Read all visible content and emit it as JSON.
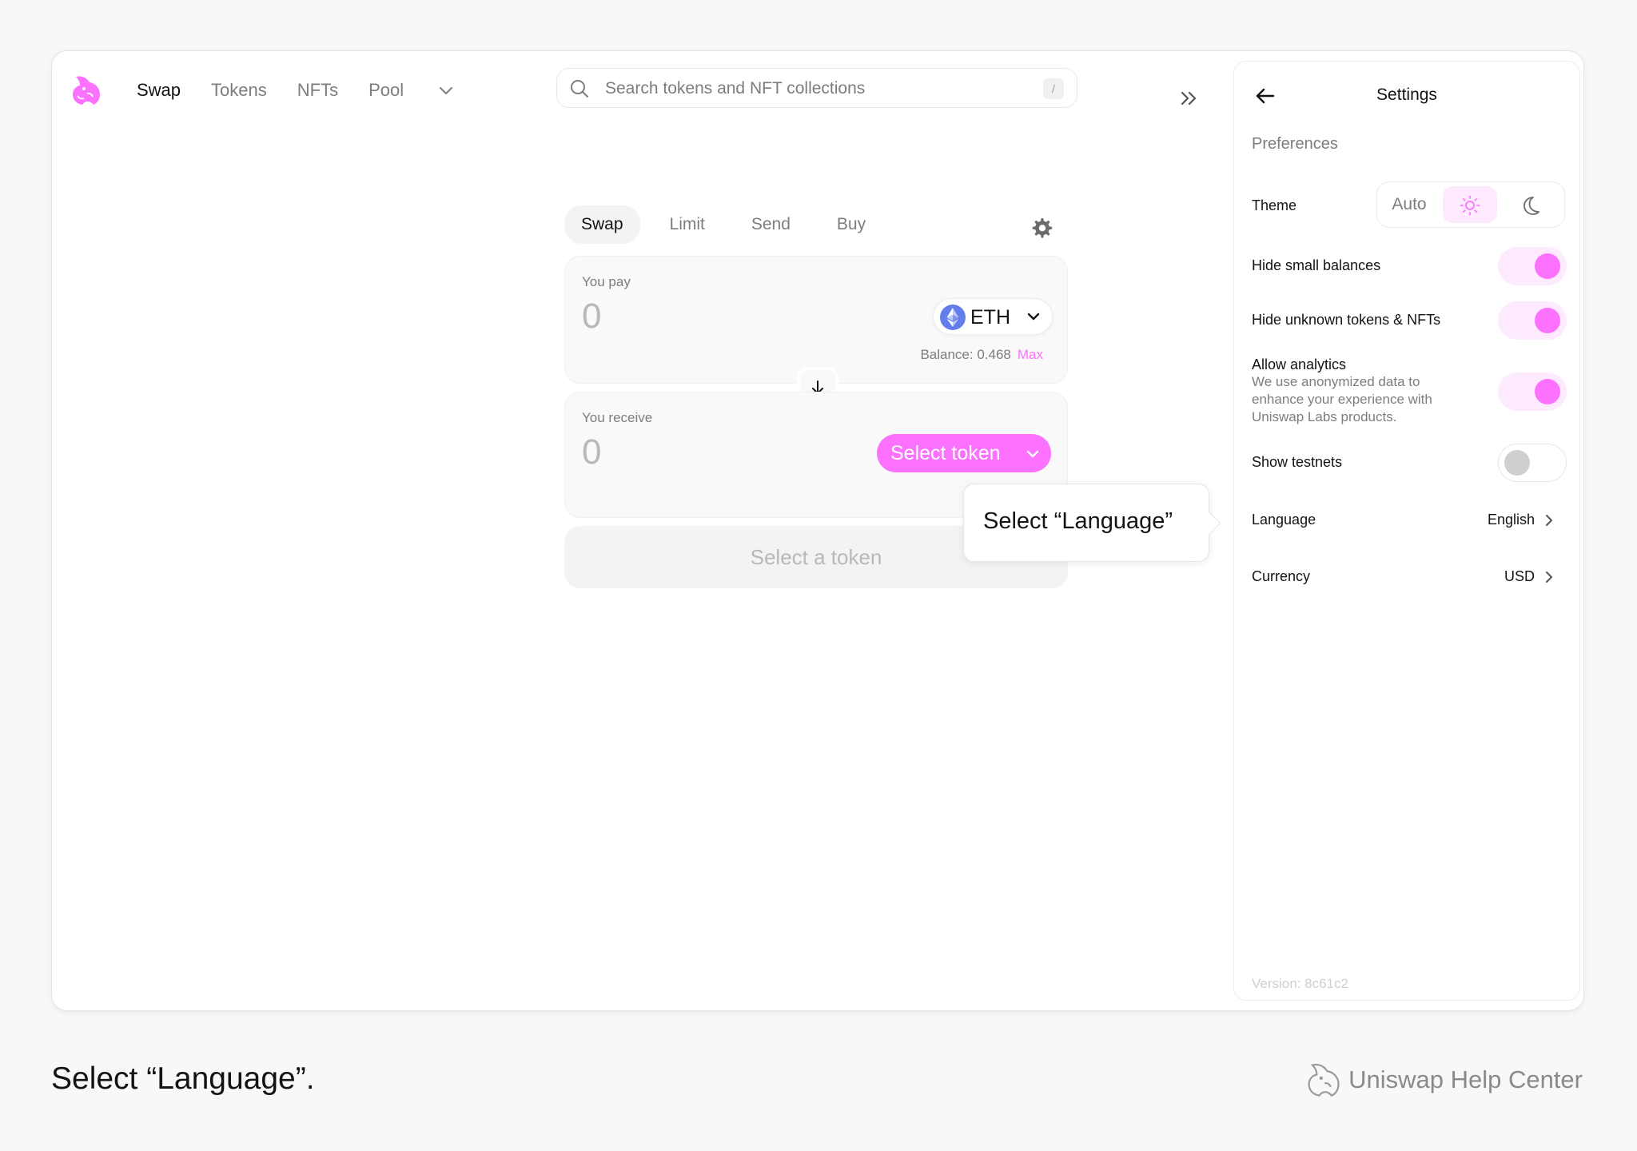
{
  "nav": {
    "items": [
      "Swap",
      "Tokens",
      "NFTs",
      "Pool"
    ],
    "active": "Swap"
  },
  "search": {
    "placeholder": "Search tokens and NFT collections",
    "shortcut": "/"
  },
  "swap": {
    "tabs": [
      "Swap",
      "Limit",
      "Send",
      "Buy"
    ],
    "active_tab": "Swap",
    "pay": {
      "label": "You pay",
      "amount": "0",
      "token": "ETH",
      "balance_label": "Balance: 0.468",
      "max_label": "Max"
    },
    "receive": {
      "label": "You receive",
      "amount": "0",
      "select_label": "Select token"
    },
    "submit_label": "Select a token"
  },
  "tooltip": {
    "text": "Select “Language”"
  },
  "settings": {
    "title": "Settings",
    "section": "Preferences",
    "theme": {
      "label": "Theme",
      "auto_label": "Auto",
      "selected": "light"
    },
    "toggles": [
      {
        "label": "Hide small balances",
        "on": true
      },
      {
        "label": "Hide unknown tokens & NFTs",
        "on": true
      },
      {
        "label": "Allow analytics",
        "sub": "We use anonymized data to enhance your experience with Uniswap Labs products.",
        "on": true
      },
      {
        "label": "Show testnets",
        "on": false
      }
    ],
    "language": {
      "label": "Language",
      "value": "English"
    },
    "currency": {
      "label": "Currency",
      "value": "USD"
    },
    "version": "Version: 8c61c2"
  },
  "footer": {
    "caption": "Select “Language”.",
    "brand": "Uniswap Help Center"
  },
  "colors": {
    "accent": "#fc72ff",
    "accent_soft": "#fdeafe",
    "text": "#131313",
    "muted": "#7d7d7d"
  }
}
